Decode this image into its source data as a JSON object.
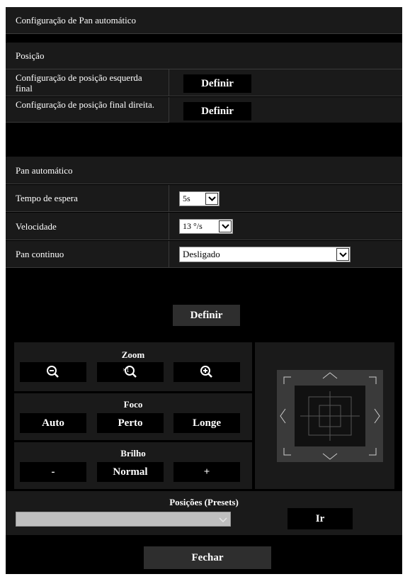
{
  "autopan": {
    "title": "Configuração de Pan automático",
    "position_header": "Posição",
    "left_end_label": "Configuração de posição esquerda final",
    "right_end_label": "Configuração de posição final direita.",
    "set_button": "Definir",
    "autopan_header": "Pan automático",
    "wait_time_label": "Tempo de espera",
    "wait_time_value": "5s",
    "speed_label": "Velocidade",
    "speed_value": "13 °/s",
    "continuous_label": "Pan continuo",
    "continuous_value": "Desligado",
    "apply_button": "Definir"
  },
  "controls": {
    "zoom_title": "Zoom",
    "zoom_in_badge": "×1",
    "focus_title": "Foco",
    "focus_auto": "Auto",
    "focus_near": "Perto",
    "focus_far": "Longe",
    "brightness_title": "Brilho",
    "brightness_minus": "-",
    "brightness_normal": "Normal",
    "brightness_plus": "+"
  },
  "presets": {
    "title": "Posições (Presets)",
    "selected": "",
    "go_button": "Ir"
  },
  "close_button": "Fechar",
  "colors": {
    "background": "#000000",
    "panel": "#1a1a1a",
    "divider": "#3a3a3a",
    "text": "#ffffff"
  },
  "icons": [
    "zoom-out-icon",
    "zoom-reset-icon",
    "zoom-in-icon",
    "chevron-down-icon",
    "pan-tilt-pad"
  ]
}
